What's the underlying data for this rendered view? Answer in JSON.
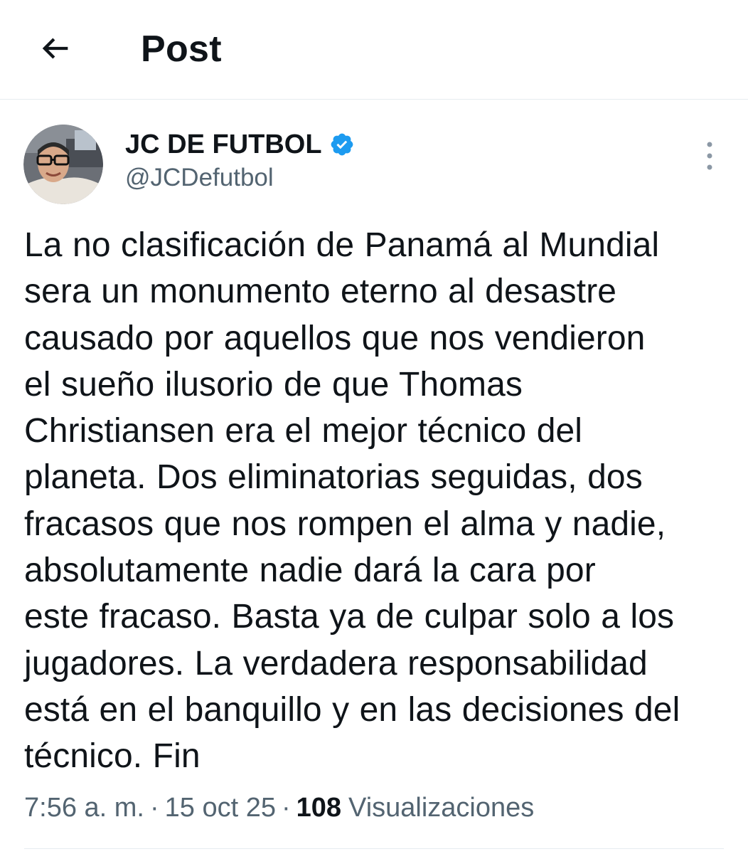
{
  "header": {
    "title": "Post",
    "back_icon": "arrow-left-icon"
  },
  "author": {
    "display_name": "JC DE FUTBOL",
    "handle": "@JCDefutbol",
    "verified": true,
    "verified_color": "#1d9bf0",
    "avatar_icon": "user-avatar"
  },
  "tweet": {
    "lines": [
      "La no clasificación de Panamá al Mundial",
      "sera un monumento eterno al desastre",
      "causado por aquellos que nos vendieron",
      "el sueño ilusorio de que Thomas",
      "Christiansen era el mejor técnico del",
      "planeta. Dos eliminatorias seguidas, dos",
      "fracasos que nos rompen el alma y nadie,",
      "absolutamente nadie dará la cara por",
      "este fracaso. Basta ya de culpar solo a los",
      "jugadores. La verdadera responsabilidad",
      "está en el banquillo y en las decisiones del",
      "técnico. Fin"
    ]
  },
  "meta": {
    "time": "7:56 a. m.",
    "separator": "·",
    "date": "15 oct 25",
    "views_count": "108",
    "views_label": "Visualizaciones"
  },
  "more_icon": "more-vertical-icon",
  "colors": {
    "text_primary": "#0f1419",
    "text_secondary": "#536471",
    "divider": "#e6ecf0",
    "accent": "#1d9bf0"
  }
}
